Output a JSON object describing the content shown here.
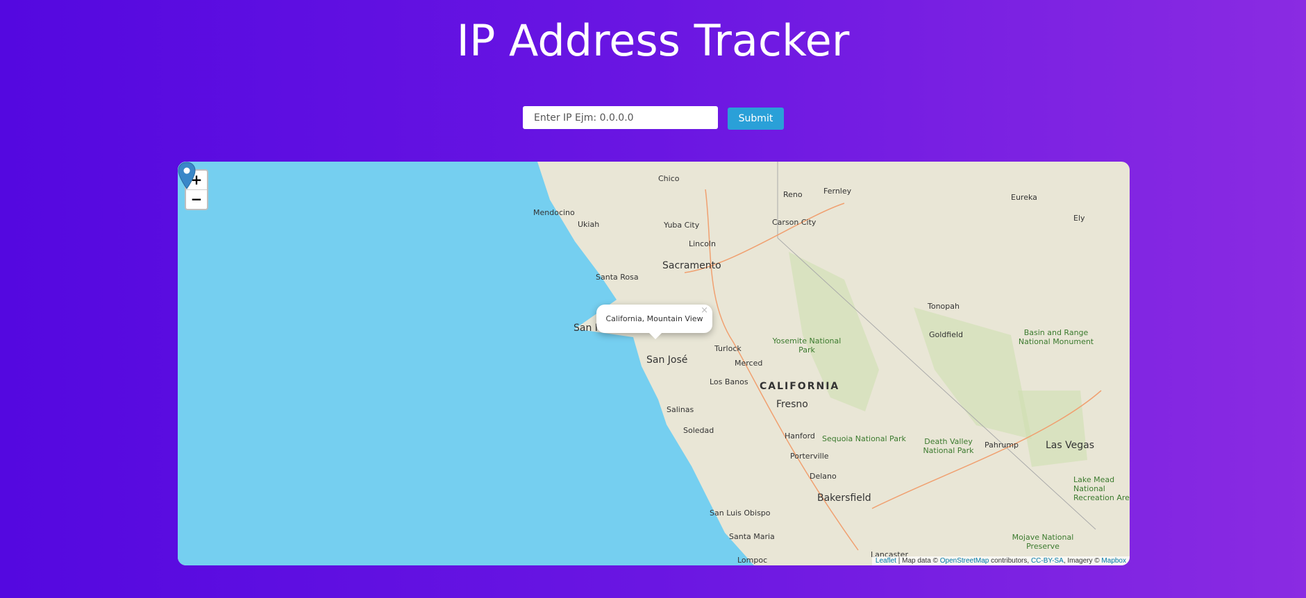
{
  "header": {
    "title": "IP Address Tracker"
  },
  "form": {
    "placeholder": "Enter IP Ejm: 0.0.0.0",
    "submit_label": "Submit"
  },
  "map": {
    "zoom_in": "+",
    "zoom_out": "−",
    "popup_text": "California, Mountain View",
    "popup_close": "×",
    "state_label": "CALIFORNIA",
    "cities": [
      "Chico",
      "Reno",
      "Fernley",
      "Eureka",
      "Ely",
      "Mendocino",
      "Ukiah",
      "Yuba City",
      "Carson City",
      "Lincoln",
      "Sacramento",
      "Santa Rosa",
      "San Francisco",
      "San José",
      "Turlock",
      "Merced",
      "Tonopah",
      "Goldfield",
      "Los Banos",
      "Fresno",
      "Salinas",
      "Soledad",
      "Hanford",
      "Porterville",
      "Pahrump",
      "Las Vegas",
      "Delano",
      "Bakersfield",
      "San Luis Obispo",
      "Santa Maria",
      "Lompoc",
      "Lancaster"
    ],
    "parks": [
      "Yosemite National Park",
      "Basin and Range National Monument",
      "Sequoia National Park",
      "Death Valley National Park",
      "Lake Mead National Recreation Area",
      "Mojave National Preserve"
    ],
    "attribution": {
      "leaflet": "Leaflet",
      "sep1": " | Map data © ",
      "osm": "OpenStreetMap",
      "sep2": " contributors, ",
      "license": "CC-BY-SA",
      "sep3": ", Imagery © ",
      "mapbox": "Mapbox"
    },
    "colors": {
      "water": "#75cff0",
      "land": "#e9e6d6",
      "marker": "#3a87c8"
    }
  }
}
